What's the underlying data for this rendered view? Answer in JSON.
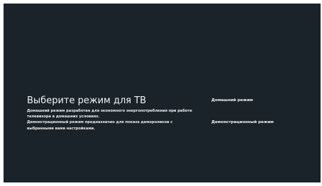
{
  "screen": {
    "title": "Выберите режим для ТВ",
    "description": [
      "Домашний режим разработан для экономного энергопотребления при работе телевизора в домашних условиях.",
      "Демонстрационный режим предназначен для показа демороликов с выбранными вами настройками."
    ],
    "options": [
      "Домашний режим",
      "Демонстрационный режим"
    ]
  },
  "colors": {
    "background": "#1a2329",
    "text": "#f2f4f5",
    "frame": "#ffffff"
  }
}
